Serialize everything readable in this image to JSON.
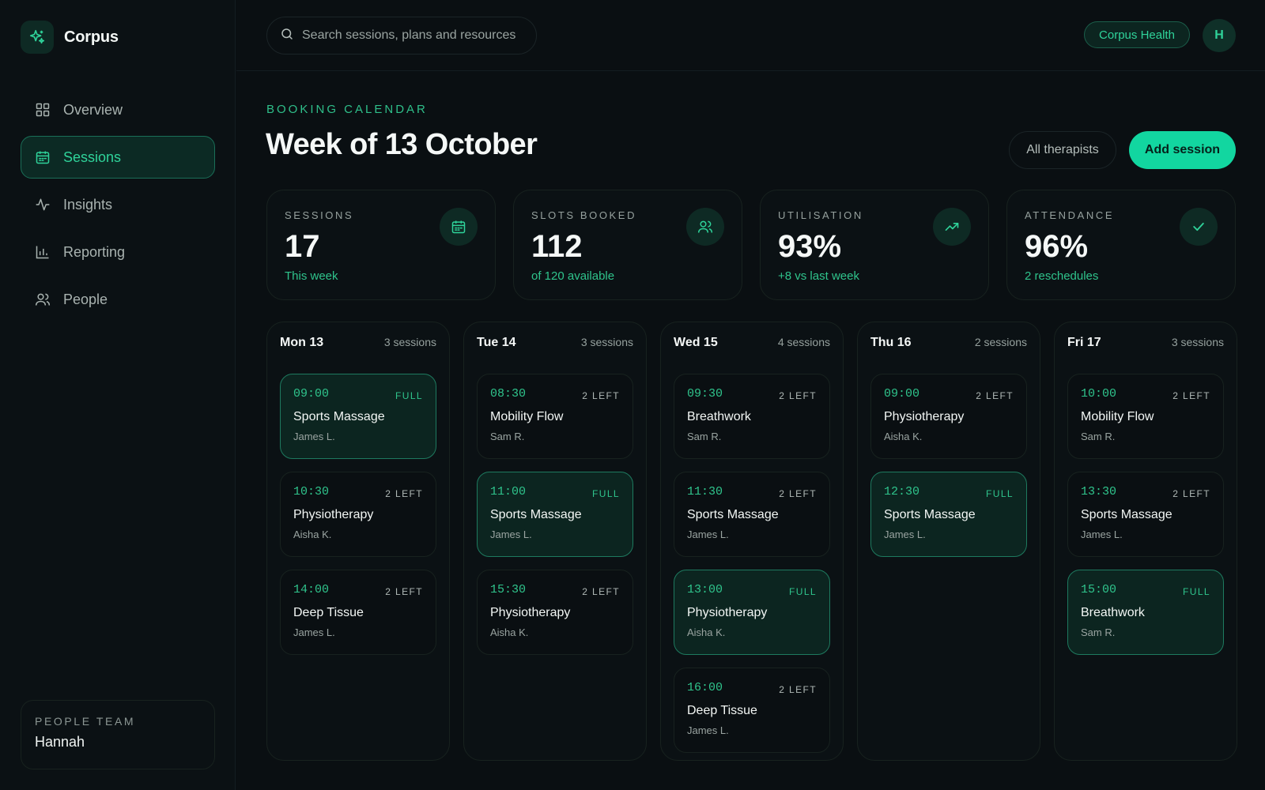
{
  "app": {
    "name": "Corpus",
    "logo_icon": "sparkles-icon",
    "accent": "#12d6a0"
  },
  "sidebar": {
    "items": [
      {
        "label": "Overview",
        "icon": "grid-icon",
        "active": false
      },
      {
        "label": "Sessions",
        "icon": "calendar-icon",
        "active": true
      },
      {
        "label": "Insights",
        "icon": "activity-icon",
        "active": false
      },
      {
        "label": "Reporting",
        "icon": "bar-chart-icon",
        "active": false
      },
      {
        "label": "People",
        "icon": "users-icon",
        "active": false
      }
    ],
    "team": {
      "label": "PEOPLE TEAM",
      "name": "Hannah"
    }
  },
  "topbar": {
    "search_placeholder": "Search sessions, plans and resources",
    "org": "Corpus Health",
    "avatar_initial": "H"
  },
  "header": {
    "eyebrow": "BOOKING CALENDAR",
    "title": "Week of 13 October",
    "filter_label": "All therapists",
    "add_label": "Add session"
  },
  "stats": [
    {
      "label": "SESSIONS",
      "value": "17",
      "sub": "This week",
      "icon": "calendar-icon"
    },
    {
      "label": "SLOTS BOOKED",
      "value": "112",
      "sub": "of 120 available",
      "icon": "users-icon"
    },
    {
      "label": "UTILISATION",
      "value": "93%",
      "sub": "+8 vs last week",
      "icon": "trending-up-icon"
    },
    {
      "label": "ATTENDANCE",
      "value": "96%",
      "sub": "2 reschedules",
      "icon": "check-icon"
    }
  ],
  "days": [
    {
      "name": "Mon 13",
      "count": "3 sessions",
      "slots": [
        {
          "time": "09:00",
          "status": "FULL",
          "title": "Sports Massage",
          "person": "James L."
        },
        {
          "time": "10:30",
          "status": "2 LEFT",
          "title": "Physiotherapy",
          "person": "Aisha K."
        },
        {
          "time": "14:00",
          "status": "2 LEFT",
          "title": "Deep Tissue",
          "person": "James L."
        }
      ]
    },
    {
      "name": "Tue 14",
      "count": "3 sessions",
      "slots": [
        {
          "time": "08:30",
          "status": "2 LEFT",
          "title": "Mobility Flow",
          "person": "Sam R."
        },
        {
          "time": "11:00",
          "status": "FULL",
          "title": "Sports Massage",
          "person": "James L."
        },
        {
          "time": "15:30",
          "status": "2 LEFT",
          "title": "Physiotherapy",
          "person": "Aisha K."
        }
      ]
    },
    {
      "name": "Wed 15",
      "count": "4 sessions",
      "slots": [
        {
          "time": "09:30",
          "status": "2 LEFT",
          "title": "Breathwork",
          "person": "Sam R."
        },
        {
          "time": "11:30",
          "status": "2 LEFT",
          "title": "Sports Massage",
          "person": "James L."
        },
        {
          "time": "13:00",
          "status": "FULL",
          "title": "Physiotherapy",
          "person": "Aisha K."
        },
        {
          "time": "16:00",
          "status": "2 LEFT",
          "title": "Deep Tissue",
          "person": "James L."
        }
      ]
    },
    {
      "name": "Thu 16",
      "count": "2 sessions",
      "slots": [
        {
          "time": "09:00",
          "status": "2 LEFT",
          "title": "Physiotherapy",
          "person": "Aisha K."
        },
        {
          "time": "12:30",
          "status": "FULL",
          "title": "Sports Massage",
          "person": "James L."
        }
      ]
    },
    {
      "name": "Fri 17",
      "count": "3 sessions",
      "slots": [
        {
          "time": "10:00",
          "status": "2 LEFT",
          "title": "Mobility Flow",
          "person": "Sam R."
        },
        {
          "time": "13:30",
          "status": "2 LEFT",
          "title": "Sports Massage",
          "person": "James L."
        },
        {
          "time": "15:00",
          "status": "FULL",
          "title": "Breathwork",
          "person": "Sam R."
        }
      ]
    }
  ]
}
